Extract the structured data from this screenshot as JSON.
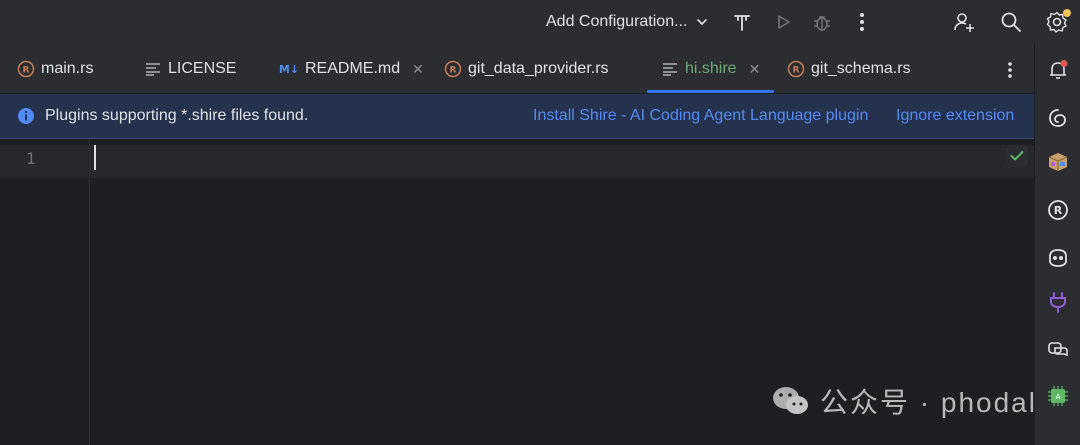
{
  "toolbar": {
    "run_config_label": "Add Configuration...",
    "icons": [
      "build-icon",
      "run-icon",
      "debug-icon",
      "more-vertical-icon",
      "add-user-icon",
      "search-icon",
      "settings-icon"
    ]
  },
  "tabs": [
    {
      "label": "main.rs",
      "icon": "rust-icon",
      "active": false,
      "closable": false
    },
    {
      "label": "LICENSE",
      "icon": "text-file-icon",
      "active": false,
      "closable": false
    },
    {
      "label": "README.md",
      "icon": "markdown-icon",
      "badge": "M↓",
      "active": false,
      "closable": true
    },
    {
      "label": "git_data_provider.rs",
      "icon": "rust-icon",
      "active": false,
      "closable": false
    },
    {
      "label": "hi.shire",
      "icon": "text-file-icon",
      "active": true,
      "closable": true
    },
    {
      "label": "git_schema.rs",
      "icon": "rust-icon",
      "active": false,
      "closable": false
    }
  ],
  "banner": {
    "message": "Plugins supporting *.shire files found.",
    "install_link": "Install Shire - AI Coding Agent Language plugin",
    "ignore_link": "Ignore extension"
  },
  "editor": {
    "line_numbers": [
      "1"
    ],
    "content": ""
  },
  "right_sidebar": {
    "icons": [
      "notifications-icon",
      "ai-assistant-icon",
      "package-icon",
      "rust-icon",
      "copilot-icon",
      "plugin-icon",
      "chat-icon"
    ]
  },
  "watermark": {
    "text": "公众号 · phodal"
  },
  "colors": {
    "accent": "#3574f0",
    "link": "#548af7",
    "active_tab_text": "#6aab73",
    "banner_bg": "#25324d",
    "editor_bg": "#1e1f22",
    "panel_bg": "#2b2d30"
  }
}
